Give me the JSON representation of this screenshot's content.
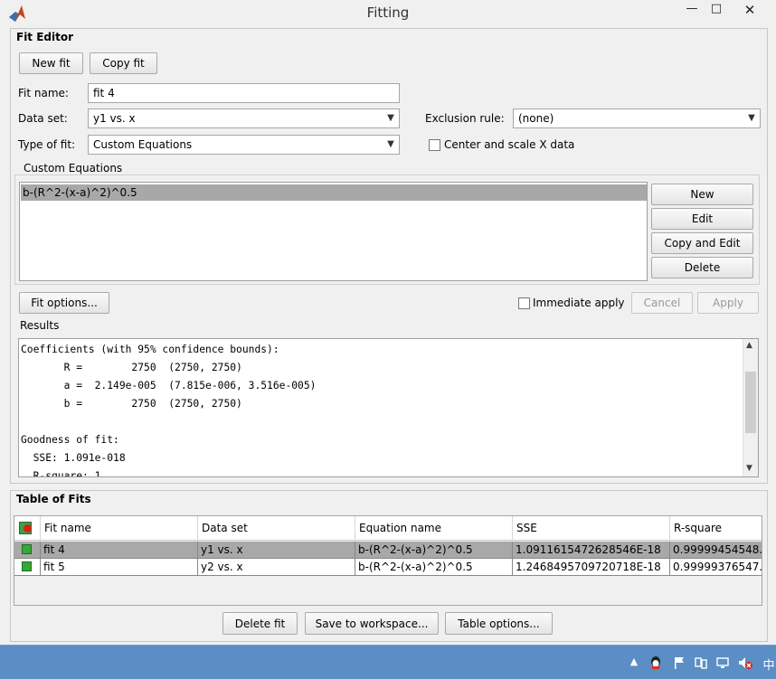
{
  "window": {
    "title": "Fitting",
    "minimize": "—",
    "maximize": "□",
    "close": "✕"
  },
  "fit_editor": {
    "heading": "Fit Editor",
    "new_fit": "New fit",
    "copy_fit": "Copy fit",
    "fit_name_label": "Fit name:",
    "fit_name_value": "fit 4",
    "data_set_label": "Data set:",
    "data_set_value": "y1 vs. x",
    "exclusion_label": "Exclusion rule:",
    "exclusion_value": "(none)",
    "type_label": "Type of fit:",
    "type_value": "Custom Equations",
    "center_scale_label": "Center and scale X data",
    "custom_equations_label": "Custom Equations",
    "equations": [
      "b-(R^2-(x-a)^2)^0.5"
    ],
    "eq_buttons": [
      "New",
      "Edit",
      "Copy and Edit",
      "Delete"
    ],
    "fit_options": "Fit options...",
    "immediate_apply": "Immediate apply",
    "cancel": "Cancel",
    "apply": "Apply",
    "results_label": "Results",
    "results_lines": [
      "Coefficients (with 95% confidence bounds):",
      "       R =        2750  (2750, 2750)",
      "       a =  2.149e-005  (7.815e-006, 3.516e-005)",
      "       b =        2750  (2750, 2750)",
      "",
      "Goodness of fit:",
      "  SSE: 1.091e-018",
      "  R-square: 1"
    ]
  },
  "table_of_fits": {
    "heading": "Table of Fits",
    "columns": [
      "Fit name",
      "Data set",
      "Equation name",
      "SSE",
      "R-square"
    ],
    "rows": [
      [
        "fit 4",
        "y1 vs. x",
        "b-(R^2-(x-a)^2)^0.5",
        "1.0911615472628546E-18",
        "0.99999454548..."
      ],
      [
        "fit 5",
        "y2 vs. x",
        "b-(R^2-(x-a)^2)^0.5",
        "1.2468495709720718E-18",
        "0.99999376547..."
      ]
    ],
    "delete_fit": "Delete fit",
    "save_workspace": "Save to workspace...",
    "table_options": "Table options..."
  },
  "taskbar": {
    "tray_icons": [
      "chevron-up-icon",
      "qq-icon",
      "flag-icon",
      "network-icon",
      "display-icon",
      "volume-muted-icon"
    ],
    "ime_label": "中"
  },
  "colors": {
    "selected_row": "#a8a8a8",
    "status_green": "#35a838",
    "taskbar": "#5a8ec4"
  }
}
